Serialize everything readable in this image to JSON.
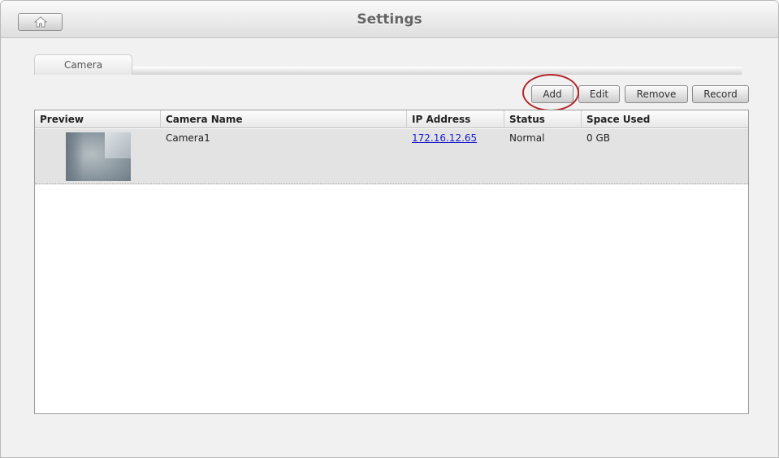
{
  "window": {
    "title": "Settings"
  },
  "tabs": [
    {
      "label": "Camera",
      "selected": true
    }
  ],
  "toolbar": {
    "add": "Add",
    "edit": "Edit",
    "remove": "Remove",
    "record": "Record"
  },
  "table": {
    "columns": [
      "Preview",
      "Camera Name",
      "IP Address",
      "Status",
      "Space Used"
    ],
    "rows": [
      {
        "camera_name": "Camera1",
        "ip_address": "172.16.12.65",
        "status": "Normal",
        "space_used": "0 GB"
      }
    ]
  },
  "icons": {
    "home": "home-icon",
    "preview": "camera-preview-thumbnail"
  },
  "colors": {
    "highlight_ring": "#b3262c",
    "link": "#1a1acc",
    "selected_row": "#e3e3e3"
  }
}
